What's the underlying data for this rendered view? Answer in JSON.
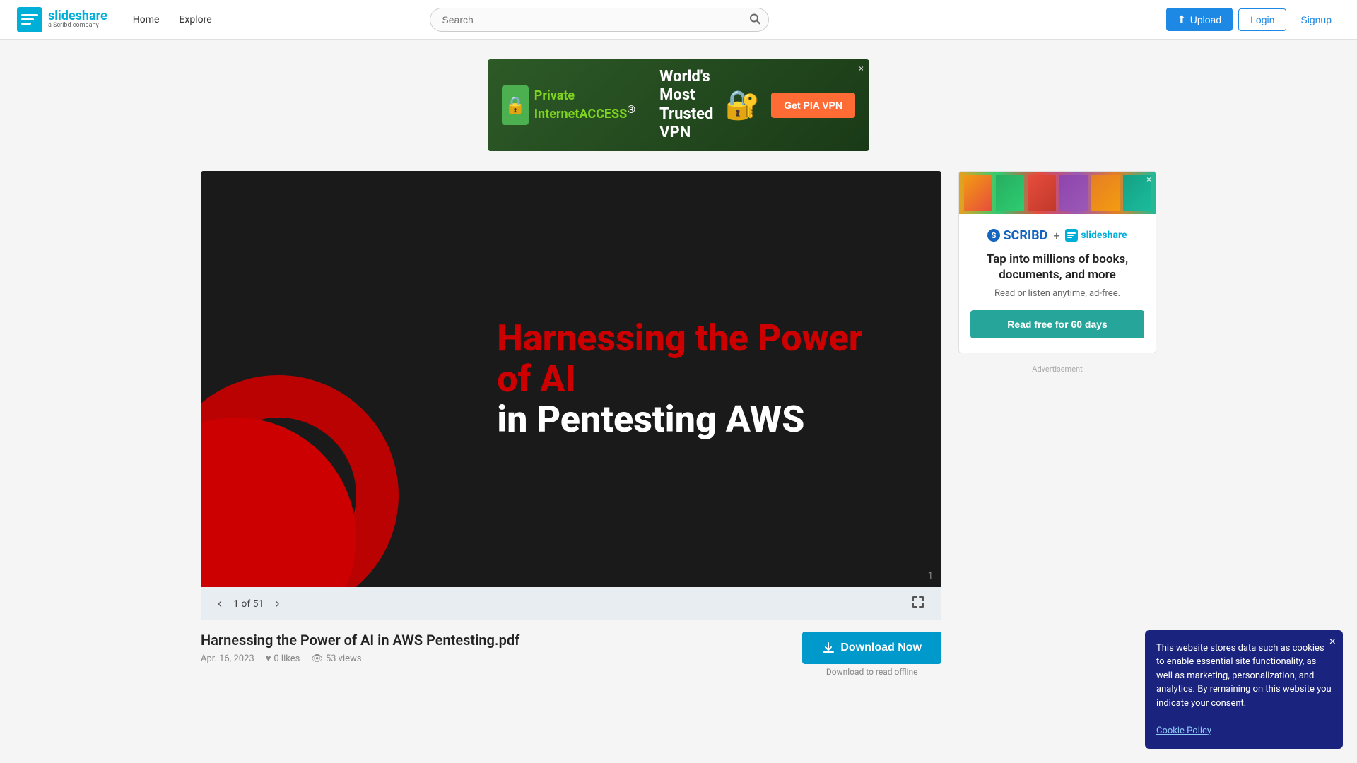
{
  "header": {
    "logo_main": "slideshare",
    "logo_sub": "a Scribd company",
    "nav": [
      {
        "label": "Home",
        "id": "home"
      },
      {
        "label": "Explore",
        "id": "explore"
      }
    ],
    "search_placeholder": "Search",
    "upload_label": "Upload",
    "login_label": "Login",
    "signup_label": "Signup"
  },
  "ad": {
    "brand": "Private Internet",
    "brand_highlight": "ACCESS",
    "registered": "®",
    "headline": "World's Most\nTrusted VPN",
    "cta": "Get PIA VPN",
    "close_label": "×"
  },
  "slide": {
    "title": "Harnessing the Power of AI in AWS Pentesting.pdf",
    "date": "Apr. 16, 2023",
    "likes": "0 likes",
    "views": "53 views",
    "current_page": "1",
    "total_pages": "51",
    "page_info": "1 of 51",
    "slide_title_line1": "Harnessing the Power of AI",
    "slide_title_line2": "in Pentesting AWS",
    "page_number": "1",
    "download_btn": "Download Now",
    "download_sub": "Download to read offline"
  },
  "sidebar": {
    "promo_headline": "Tap into millions of books, documents, and more",
    "promo_sub": "Read or listen anytime, ad-free.",
    "scribd_label": "SCRIBD",
    "plus_label": "+",
    "slideshare_label": "slideshare",
    "cta_label": "Read free for 60 days",
    "ad_label": "Advertisement"
  },
  "cookie": {
    "text": "This website stores data such as cookies to enable essential site functionality, as well as marketing, personalization, and analytics. By remaining on this website you indicate your consent.",
    "link_text": "Cookie Policy",
    "close_label": "×"
  },
  "icons": {
    "search": "🔍",
    "upload": "⬆",
    "prev": "‹",
    "next": "›",
    "fullscreen": "⛶",
    "download": "⬇",
    "like": "♥",
    "eye": "👁",
    "close": "×"
  },
  "colors": {
    "brand_blue": "#00afd7",
    "action_blue": "#1e88e5",
    "download_teal": "#0099cc",
    "red": "#cc0000",
    "scribd_blue": "#1565c0",
    "promo_teal": "#26a69a"
  }
}
